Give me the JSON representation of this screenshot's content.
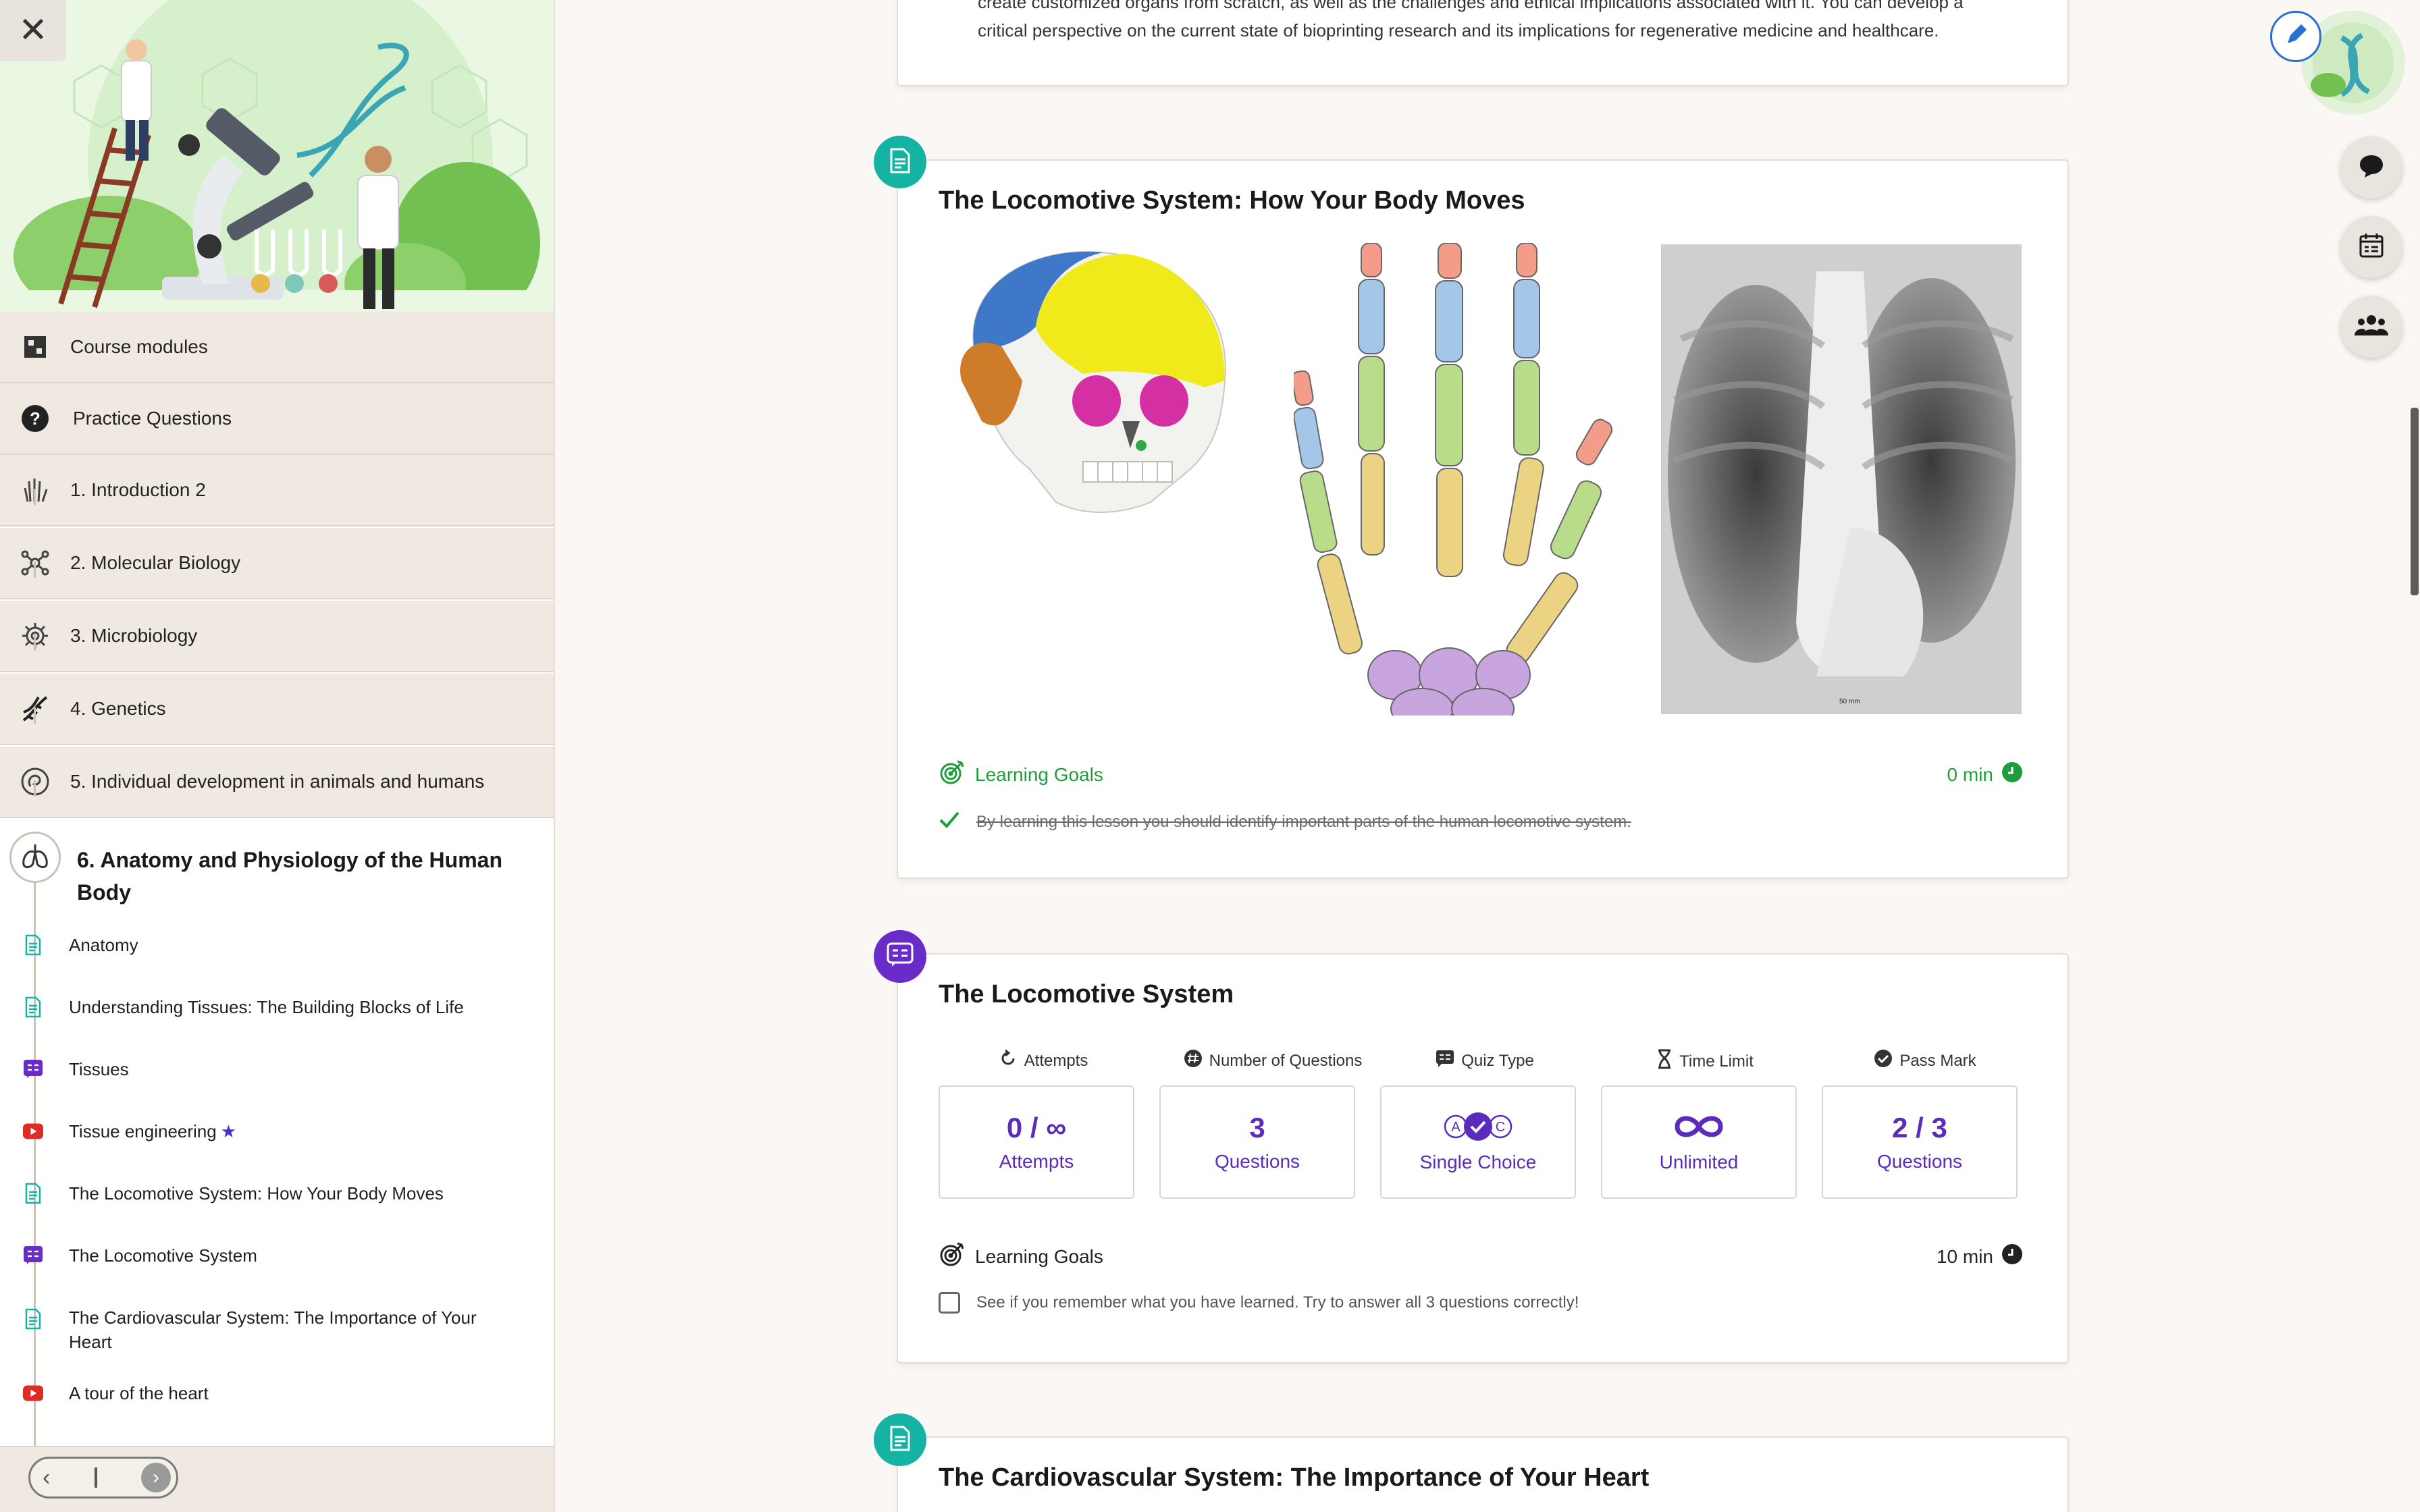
{
  "sidebar": {
    "close_label": "✕",
    "menu": [
      {
        "label": "Course modules",
        "icon": "puzzle-icon"
      },
      {
        "label": "Practice Questions",
        "icon": "help-circle-icon"
      },
      {
        "label": "1. Introduction 2",
        "icon": "wave-hand-icon"
      },
      {
        "label": "2. Molecular Biology",
        "icon": "molecule-icon"
      },
      {
        "label": "3. Microbiology",
        "icon": "virus-icon"
      },
      {
        "label": "4. Genetics",
        "icon": "dna-icon"
      },
      {
        "label": "5. Individual development in animals and humans",
        "icon": "embryo-icon"
      }
    ],
    "active_chapter": {
      "title": "6. Anatomy and Physiology of the Human Body",
      "icon": "lungs-icon"
    },
    "lessons": [
      {
        "label": "Anatomy",
        "type": "document"
      },
      {
        "label": "Understanding Tissues: The Building Blocks of Life",
        "type": "document"
      },
      {
        "label": "Tissues",
        "type": "quiz"
      },
      {
        "label": "Tissue engineering",
        "type": "video",
        "starred": true,
        "star": "★"
      },
      {
        "label": "The Locomotive System: How Your Body Moves",
        "type": "document"
      },
      {
        "label": "The Locomotive System",
        "type": "quiz"
      },
      {
        "label": "The Cardiovascular System: The Importance of Your Heart",
        "type": "document"
      },
      {
        "label": "A tour of the heart",
        "type": "video"
      }
    ],
    "pager": {
      "prev": "‹",
      "next": "›"
    }
  },
  "top_card": {
    "text": "create customized organs from scratch, as well as the challenges and ethical implications associated with it. You can develop a critical perspective on the current state of bioprinting research and its implications for regenerative medicine and healthcare."
  },
  "lesson_card": {
    "title": "The Locomotive System: How Your Body Moves",
    "xray_scale": "50 mm",
    "goals_label": "Learning Goals",
    "duration": "0 min",
    "goal": "By learning this lesson you should identify important parts of the human locomotive system."
  },
  "quiz_card": {
    "title": "The Locomotive System",
    "stats": [
      {
        "head": "Attempts",
        "icon": "refresh-icon",
        "big": "0 / ∞",
        "small": "Attempts"
      },
      {
        "head": "Number of Questions",
        "icon": "hash-icon",
        "big": "3",
        "small": "Questions"
      },
      {
        "head": "Quiz Type",
        "icon": "quiz-type-icon",
        "big": "",
        "small": "Single Choice"
      },
      {
        "head": "Time Limit",
        "icon": "hourglass-icon",
        "big": "",
        "small": "Unlimited"
      },
      {
        "head": "Pass Mark",
        "icon": "check-circle-icon",
        "big": "2 / 3",
        "small": "Questions"
      }
    ],
    "goals_label": "Learning Goals",
    "duration": "10 min",
    "goal": "See if you remember what you have learned. Try to answer all 3 questions correctly!"
  },
  "next_card": {
    "title": "The Cardiovascular System: The Importance of Your Heart"
  },
  "colors": {
    "teal": "#14b3a3",
    "purple": "#6a2cc8",
    "green_done": "#1e9e3a",
    "video_red": "#e02b20"
  }
}
